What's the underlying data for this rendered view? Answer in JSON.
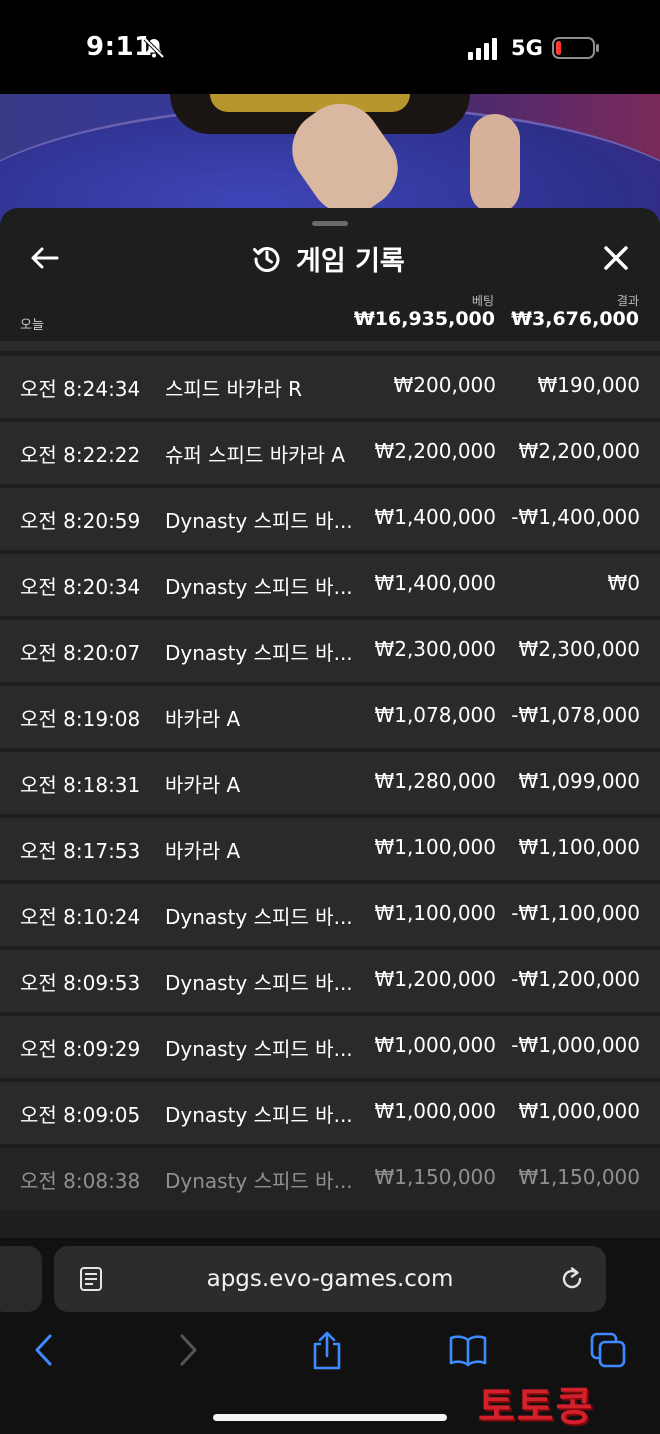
{
  "status_bar": {
    "time": "9:11",
    "network": "5G"
  },
  "panel": {
    "title": "게임 기록",
    "today_label": "오늘",
    "bet_column_label": "베팅",
    "result_column_label": "결과",
    "bet_total": "₩16,935,000",
    "result_total": "₩3,676,000"
  },
  "rows": [
    {
      "time": "오전 8:24:34",
      "game": "스피드 바카라 R",
      "bet": "₩200,000",
      "result": "₩190,000"
    },
    {
      "time": "오전 8:22:22",
      "game": "슈퍼 스피드 바카라 A",
      "bet": "₩2,200,000",
      "result": "₩2,200,000"
    },
    {
      "time": "오전 8:20:59",
      "game": "Dynasty 스피드 바...",
      "bet": "₩1,400,000",
      "result": "-₩1,400,000"
    },
    {
      "time": "오전 8:20:34",
      "game": "Dynasty 스피드 바...",
      "bet": "₩1,400,000",
      "result": "₩0"
    },
    {
      "time": "오전 8:20:07",
      "game": "Dynasty 스피드 바...",
      "bet": "₩2,300,000",
      "result": "₩2,300,000"
    },
    {
      "time": "오전 8:19:08",
      "game": "바카라 A",
      "bet": "₩1,078,000",
      "result": "-₩1,078,000"
    },
    {
      "time": "오전 8:18:31",
      "game": "바카라 A",
      "bet": "₩1,280,000",
      "result": "₩1,099,000"
    },
    {
      "time": "오전 8:17:53",
      "game": "바카라 A",
      "bet": "₩1,100,000",
      "result": "₩1,100,000"
    },
    {
      "time": "오전 8:10:24",
      "game": "Dynasty 스피드 바...",
      "bet": "₩1,100,000",
      "result": "-₩1,100,000"
    },
    {
      "time": "오전 8:09:53",
      "game": "Dynasty 스피드 바...",
      "bet": "₩1,200,000",
      "result": "-₩1,200,000"
    },
    {
      "time": "오전 8:09:29",
      "game": "Dynasty 스피드 바...",
      "bet": "₩1,000,000",
      "result": "-₩1,000,000"
    },
    {
      "time": "오전 8:09:05",
      "game": "Dynasty 스피드 바...",
      "bet": "₩1,000,000",
      "result": "₩1,000,000"
    },
    {
      "time": "오전 8:08:38",
      "game": "Dynasty 스피드 바...",
      "bet": "₩1,150,000",
      "result": "₩1,150,000"
    }
  ],
  "browser": {
    "address": "apgs.evo-games.com"
  },
  "watermark": "토토콩",
  "icons": {
    "back": "arrow-left-icon",
    "history": "history-clock-icon",
    "close": "close-icon",
    "reader": "reader-mode-icon",
    "reload": "reload-icon",
    "nav_back": "chevron-left-icon",
    "nav_forward": "chevron-right-icon",
    "share": "share-icon",
    "bookmarks": "book-icon",
    "tabs": "tabs-icon"
  },
  "colors": {
    "accent": "#3d8bff",
    "battery_low": "#ff3b30",
    "panel_bg": "#1e1e1f",
    "row_bg": "#2a2a2b",
    "watermark": "#d4202a"
  }
}
